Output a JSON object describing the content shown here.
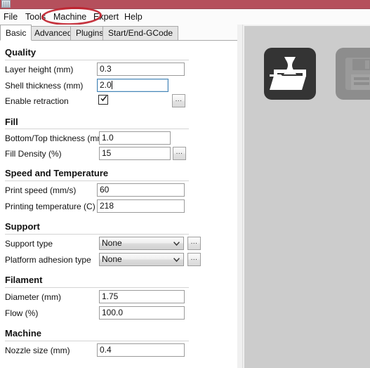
{
  "window": {
    "titlebar_color": "#b5505c",
    "system_icon": "window-icon"
  },
  "menubar": {
    "items": [
      {
        "label": "File",
        "name": "menu-file"
      },
      {
        "label": "Tools",
        "name": "menu-tools"
      },
      {
        "label": "Machine",
        "name": "menu-machine"
      },
      {
        "label": "Expert",
        "name": "menu-expert"
      },
      {
        "label": "Help",
        "name": "menu-help"
      }
    ]
  },
  "annotation": {
    "shape": "ellipse",
    "color": "#c0222e",
    "targets": "Machine"
  },
  "tabs": {
    "selected": "Basic",
    "items": [
      {
        "label": "Basic"
      },
      {
        "label": "Advanced"
      },
      {
        "label": "Plugins"
      },
      {
        "label": "Start/End-GCode"
      }
    ]
  },
  "settings": {
    "groups": [
      {
        "title": "Quality",
        "fields": [
          {
            "label": "Layer height (mm)",
            "value": "0.3",
            "type": "text",
            "focused": false
          },
          {
            "label": "Shell thickness (mm)",
            "value": "2.0",
            "type": "text",
            "focused": true
          },
          {
            "label": "Enable retraction",
            "value": "",
            "type": "checkbox",
            "checked": true,
            "dots": "..."
          }
        ]
      },
      {
        "title": "Fill",
        "fields": [
          {
            "label": "Bottom/Top thickness (mm)",
            "value": "1.0",
            "type": "text"
          },
          {
            "label": "Fill Density (%)",
            "value": "15",
            "type": "text",
            "dots": "..."
          }
        ]
      },
      {
        "title": "Speed and Temperature",
        "fields": [
          {
            "label": "Print speed (mm/s)",
            "value": "60",
            "type": "text"
          },
          {
            "label": "Printing temperature (C)",
            "value": "218",
            "type": "text"
          }
        ]
      },
      {
        "title": "Support",
        "fields": [
          {
            "label": "Support type",
            "value": "None",
            "type": "combo",
            "dots": "..."
          },
          {
            "label": "Platform adhesion type",
            "value": "None",
            "type": "combo",
            "dots": "..."
          }
        ]
      },
      {
        "title": "Filament",
        "fields": [
          {
            "label": "Diameter (mm)",
            "value": "1.75",
            "type": "text"
          },
          {
            "label": "Flow (%)",
            "value": "100.0",
            "type": "text"
          }
        ]
      },
      {
        "title": "Machine",
        "fields": [
          {
            "label": "Nozzle size (mm)",
            "value": "0.4",
            "type": "text"
          }
        ]
      }
    ]
  },
  "viewpanel": {
    "background": "#cccccc",
    "buttons": [
      {
        "name": "load-model-button",
        "icon": "load-model-icon",
        "enabled": true,
        "color": "#343434"
      },
      {
        "name": "save-toolpath-button",
        "icon": "save-floppy-icon",
        "enabled": false,
        "color": "#8d8d8d"
      }
    ]
  }
}
